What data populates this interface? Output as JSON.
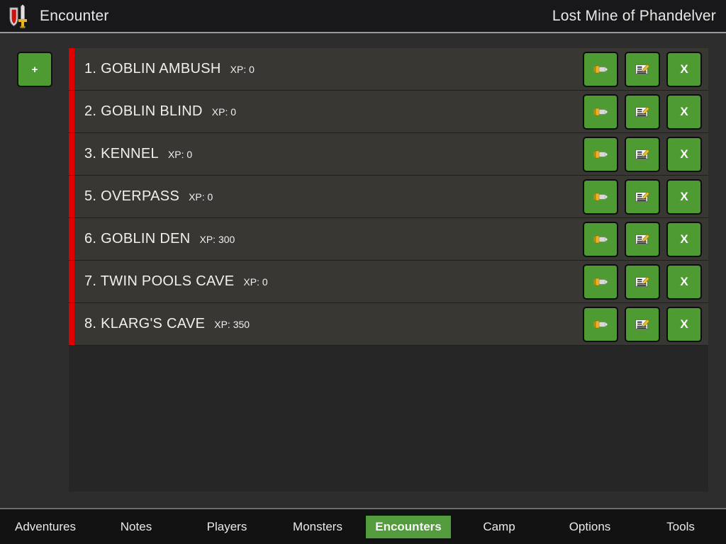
{
  "header": {
    "app_icon": "shield-sword-icon",
    "app_title": "Encounter",
    "adventure_title": "Lost Mine of Phandelver"
  },
  "toolbar": {
    "add_label": "+",
    "add_icon": "plus-icon"
  },
  "colors": {
    "accent_green": "#4f9b33",
    "row_accent_red": "#e00000",
    "header_bg": "#18181a",
    "row_bg": "#393733",
    "list_bg": "#262626",
    "page_bg": "#2d2d2d",
    "tabbar_bg": "#121212",
    "active_tab_bg": "#549b3d"
  },
  "encounters": {
    "row_actions": {
      "run_icon": "sword-icon",
      "edit_icon": "edit-note-icon",
      "delete_label": "X",
      "delete_icon": "close-x-icon"
    },
    "xp_prefix": "XP:",
    "rows": [
      {
        "title": "1. GOBLIN AMBUSH",
        "xp": "XP: 0"
      },
      {
        "title": "2. GOBLIN BLIND",
        "xp": "XP: 0"
      },
      {
        "title": "3. KENNEL",
        "xp": "XP: 0"
      },
      {
        "title": "5. OVERPASS",
        "xp": "XP: 0"
      },
      {
        "title": "6. GOBLIN DEN",
        "xp": "XP: 300"
      },
      {
        "title": "7. TWIN POOLS CAVE",
        "xp": "XP: 0"
      },
      {
        "title": "8. KLARG'S CAVE",
        "xp": "XP: 350"
      }
    ]
  },
  "tabs": [
    {
      "label": "Adventures",
      "active": false
    },
    {
      "label": "Notes",
      "active": false
    },
    {
      "label": "Players",
      "active": false
    },
    {
      "label": "Monsters",
      "active": false
    },
    {
      "label": "Encounters",
      "active": true
    },
    {
      "label": "Camp",
      "active": false
    },
    {
      "label": "Options",
      "active": false
    },
    {
      "label": "Tools",
      "active": false
    }
  ]
}
